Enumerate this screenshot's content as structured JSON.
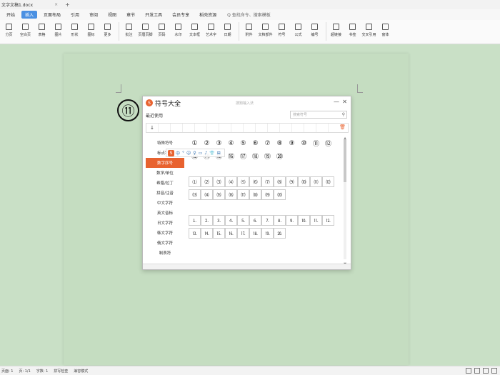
{
  "titlebar": {
    "doc_title": "文字文稿1.docx",
    "tab_close": "×",
    "tab_add": "+"
  },
  "menu": {
    "items": [
      "开始",
      "插入",
      "页面布局",
      "引用",
      "审阅",
      "视图",
      "章节",
      "开发工具",
      "会员专享",
      "稻壳资源"
    ],
    "active_index": 1,
    "search_text": "Q 查找命令、搜索模板"
  },
  "ribbon": {
    "buttons": [
      "分页",
      "空白页",
      "表格",
      "图片",
      "形状",
      "图标",
      "更多",
      "批注",
      "页眉页脚",
      "页码",
      "水印",
      "文本框",
      "艺术字",
      "日期",
      "附件",
      "文档部件",
      "符号",
      "公式",
      "编号",
      "超链接",
      "书签",
      "交叉引用",
      "窗体"
    ]
  },
  "step_badge": "⑪",
  "dialog": {
    "title": "符号大全",
    "search_hint": "搜狗输入法",
    "subtitle": "最近使用",
    "search_placeholder": "搜索符号",
    "search_icon": "search-icon",
    "recent": [
      "↓"
    ],
    "delete_icon": "trash-icon",
    "categories": [
      "特殊符号",
      "标点符号",
      "数字序号",
      "数学/单位",
      "希腊/拉丁",
      "拼音/注音",
      "中文字符",
      "英文音标",
      "日文字符",
      "韩文字符",
      "俄文字符",
      "制表符"
    ],
    "active_category": 2,
    "rows": [
      [
        "①",
        "②",
        "③",
        "④",
        "⑤",
        "⑥",
        "⑦",
        "⑧",
        "⑨",
        "⑩",
        "⑪",
        "⑫"
      ],
      [
        "⑬",
        "⑭",
        "⑮",
        "⑯",
        "⑰",
        "⑱",
        "⑲",
        "⑳"
      ],
      [
        "⑴",
        "⑵",
        "⑶",
        "⑷",
        "⑸",
        "⑹",
        "⑺",
        "⑻",
        "⑼",
        "⑽",
        "⑾",
        "⑿"
      ],
      [
        "⒀",
        "⒁",
        "⒂",
        "⒃",
        "⒄",
        "⒅",
        "⒆",
        "⒇"
      ],
      [
        "⒈",
        "⒉",
        "⒊",
        "⒋",
        "⒌",
        "⒍",
        "⒎",
        "⒏",
        "⒐",
        "⒑",
        "⒒",
        "⒓"
      ],
      [
        "⒔",
        "⒕",
        "⒖",
        "⒗",
        "⒘",
        "⒙",
        "⒚",
        "⒛"
      ]
    ],
    "min_label": "—",
    "close_label": "✕"
  },
  "imebar": {
    "ime_label": "中",
    "icons": [
      "°",
      "☺",
      "⚲",
      "▭",
      "♪",
      "👕",
      "⊞"
    ]
  },
  "status": {
    "page": "页面: 1",
    "pages": "页: 1/1",
    "words": "字数: 1",
    "spell": "拼写检查",
    "compat": "兼容模式"
  }
}
